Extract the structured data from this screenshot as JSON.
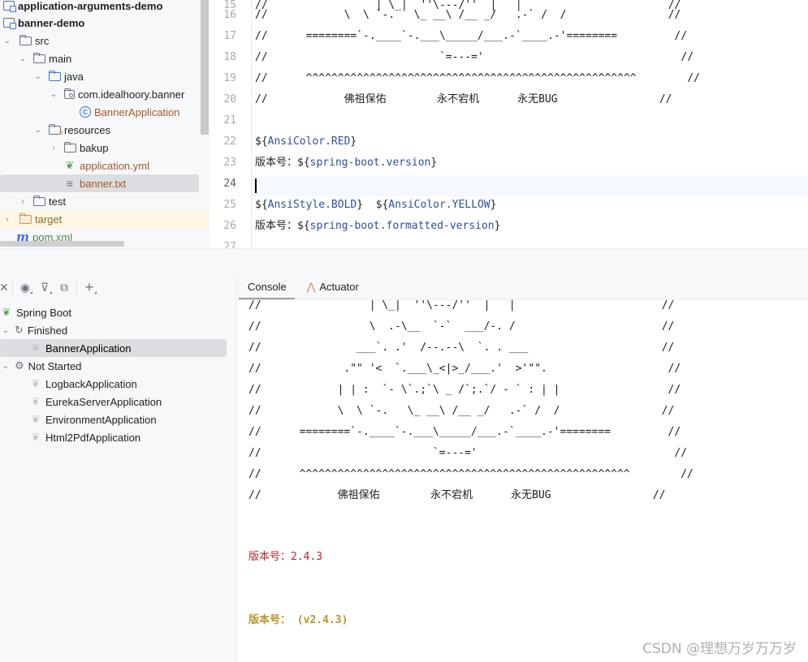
{
  "project_tree": {
    "items": [
      {
        "label": "application-arguments-demo",
        "type": "module",
        "bold": true
      },
      {
        "label": "banner-demo",
        "type": "module",
        "bold": true
      },
      {
        "label": "src",
        "type": "folder"
      },
      {
        "label": "main",
        "type": "folder"
      },
      {
        "label": "java",
        "type": "source-folder"
      },
      {
        "label": "com.idealhoory.banner",
        "type": "package"
      },
      {
        "label": "BannerApplication",
        "type": "class"
      },
      {
        "label": "resources",
        "type": "resource-folder"
      },
      {
        "label": "bakup",
        "type": "folder"
      },
      {
        "label": "application.yml",
        "type": "spring-config"
      },
      {
        "label": "banner.txt",
        "type": "text-file",
        "selected": true
      },
      {
        "label": "test",
        "type": "folder"
      },
      {
        "label": "target",
        "type": "excluded-folder"
      },
      {
        "label": "pom.xml",
        "type": "maven"
      }
    ]
  },
  "editor": {
    "file": "banner.txt",
    "current_line": 24,
    "lines": [
      {
        "n": "16",
        "text": "//            \\  \\ `-.   \\_ __\\ /__ _/   .-` /  /                //"
      },
      {
        "n": "17",
        "text": "//      ========`-.____`-.___\\_____/___.-`____.-'========         //"
      },
      {
        "n": "18",
        "text": "//                           `=---='                               //"
      },
      {
        "n": "19",
        "text": "//      ^^^^^^^^^^^^^^^^^^^^^^^^^^^^^^^^^^^^^^^^^^^^^^^^^^^^        //"
      },
      {
        "n": "20",
        "text": "//            佛祖保佑        永不宕机      永无BUG                //"
      },
      {
        "n": "21",
        "text": ""
      },
      {
        "n": "22",
        "prefix": "${",
        "placeholder": "AnsiColor.RED",
        "suffix": "}"
      },
      {
        "n": "23",
        "prefix": "版本号：${",
        "placeholder": "spring-boot.version",
        "suffix": "}"
      },
      {
        "n": "24",
        "text": ""
      },
      {
        "n": "25",
        "prefix": "${",
        "placeholder": "AnsiStyle.BOLD",
        "mid": "}  ${",
        "placeholder2": "AnsiColor.YELLOW",
        "suffix": "}"
      },
      {
        "n": "26",
        "prefix": "版本号：${",
        "placeholder": "spring-boot.formatted-version",
        "suffix": "}"
      },
      {
        "n": "27",
        "text": ""
      }
    ]
  },
  "services": {
    "toolbar": [
      "collapse-icon",
      "view-options-icon",
      "filter-icon",
      "new-group-icon",
      "add-service-icon"
    ],
    "root": "Spring Boot",
    "groups": [
      {
        "label": "Finished",
        "items": [
          {
            "label": "BannerApplication",
            "selected": true
          }
        ]
      },
      {
        "label": "Not Started",
        "items": [
          {
            "label": "LogbackApplication"
          },
          {
            "label": "EurekaServerApplication"
          },
          {
            "label": "EnvironmentApplication"
          },
          {
            "label": "Html2PdfApplication"
          }
        ]
      }
    ]
  },
  "console": {
    "tabs": [
      {
        "label": "Console",
        "active": true
      },
      {
        "label": "Actuator"
      }
    ],
    "lines": [
      "//                 | \\_|  ''\\---/''  |   |                       //",
      "//                 \\  .-\\__  `-`  ___/-. /                       //",
      "//               ___`. .'  /--.--\\  `. . ___                     //",
      "//             .\"\" '<  `.___\\_<|>_/___.'  >'\"\".                   //",
      "//            | | :  `- \\`.;`\\ _ /`;.`/ - ` : | |                 //",
      "//            \\  \\ `-.   \\_ __\\ /__ _/   .-` /  /                //",
      "//      ========`-.____`-.___\\_____/___.-`____.-'========         //",
      "//                           `=---='                               //",
      "//      ^^^^^^^^^^^^^^^^^^^^^^^^^^^^^^^^^^^^^^^^^^^^^^^^^^^^        //",
      "//            佛祖保佑        永不宕机      永无BUG                //"
    ],
    "version_red": "版本号：2.4.3",
    "version_yellow": "版本号： (v2.4.3)",
    "colors": {
      "red": "#b2262e",
      "yellow": "#b8952a"
    }
  },
  "watermark": "CSDN @理想万岁万万岁"
}
